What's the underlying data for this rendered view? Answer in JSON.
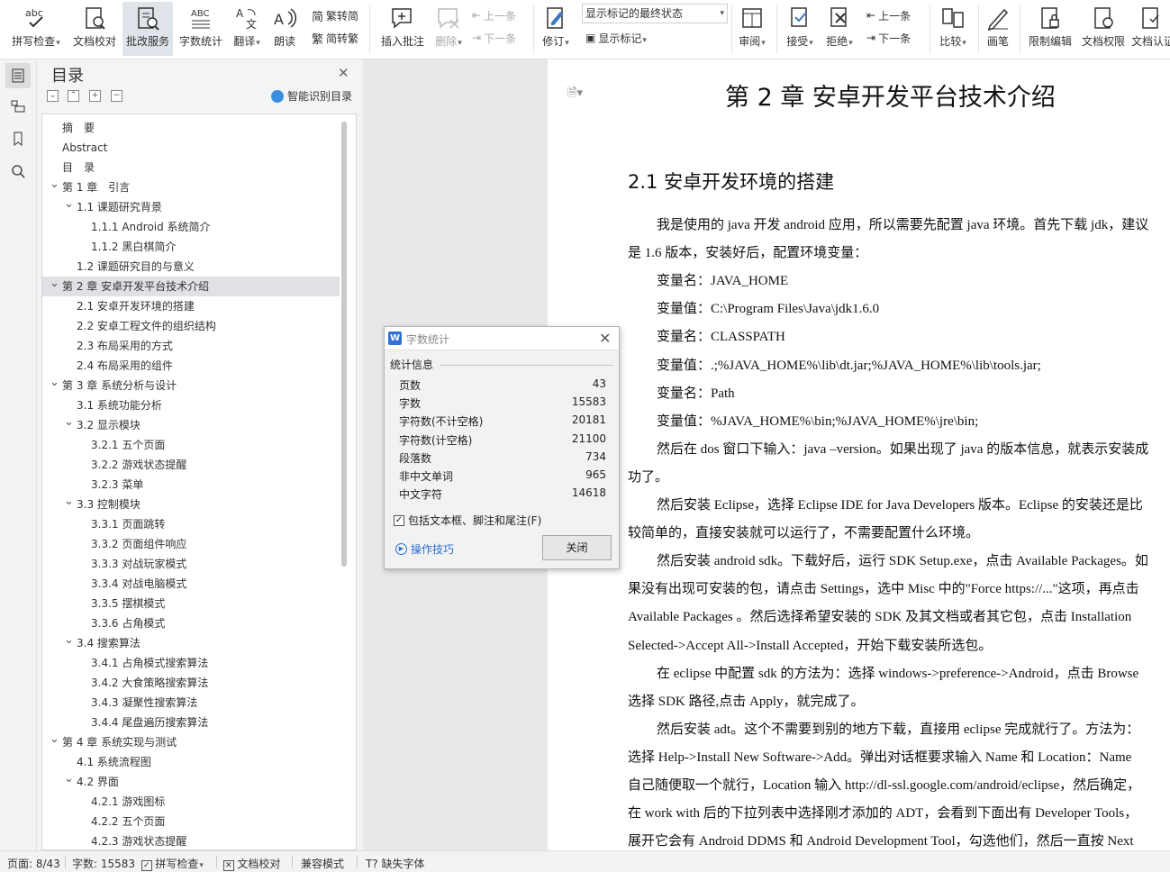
{
  "ribbon": {
    "spell_check": "拼写检查",
    "doc_proof": "文档校对",
    "batch_service": "批改服务",
    "word_count": "字数统计",
    "translate": "翻译",
    "read_aloud": "朗读",
    "trad_to_simp": "繁转简",
    "simp_to_trad": "简转繁",
    "insert_comment": "插入批注",
    "delete": "删除",
    "prev_comment": "上一条",
    "next_comment": "下一条",
    "revise": "修订",
    "markup_state": "显示标记的最终状态",
    "show_markup": "显示标记",
    "review": "审阅",
    "accept": "接受",
    "reject": "拒绝",
    "prev_change": "上一条",
    "next_change": "下一条",
    "compare": "比较",
    "pen": "画笔",
    "restrict_edit": "限制编辑",
    "doc_permission": "文档权限",
    "doc_certify": "文档认证"
  },
  "toc": {
    "title": "目录",
    "smart_label": "智能识别目录",
    "items": [
      {
        "text": "摘　要",
        "level": 0,
        "toggle": ""
      },
      {
        "text": "Abstract",
        "level": 0,
        "toggle": ""
      },
      {
        "text": "目　录",
        "level": 0,
        "toggle": ""
      },
      {
        "text": "第 1 章　引言",
        "level": 0,
        "toggle": "v"
      },
      {
        "text": "1.1 课题研究背景",
        "level": 1,
        "toggle": "v"
      },
      {
        "text": "1.1.1 Android 系统简介",
        "level": 2,
        "toggle": ""
      },
      {
        "text": "1.1.2 黑白棋简介",
        "level": 2,
        "toggle": ""
      },
      {
        "text": "1.2 课题研究目的与意义",
        "level": 1,
        "toggle": ""
      },
      {
        "text": "第 2 章 安卓开发平台技术介绍",
        "level": 0,
        "toggle": "v",
        "selected": true
      },
      {
        "text": "2.1 安卓开发环境的搭建",
        "level": 1,
        "toggle": ""
      },
      {
        "text": "2.2 安卓工程文件的组织结构",
        "level": 1,
        "toggle": ""
      },
      {
        "text": "2.3 布局采用的方式",
        "level": 1,
        "toggle": ""
      },
      {
        "text": "2.4 布局采用的组件",
        "level": 1,
        "toggle": ""
      },
      {
        "text": "第 3 章 系统分析与设计",
        "level": 0,
        "toggle": "v"
      },
      {
        "text": "3.1 系统功能分析",
        "level": 1,
        "toggle": ""
      },
      {
        "text": "3.2 显示模块",
        "level": 1,
        "toggle": "v"
      },
      {
        "text": "3.2.1 五个页面",
        "level": 2,
        "toggle": ""
      },
      {
        "text": "3.2.2 游戏状态提醒",
        "level": 2,
        "toggle": ""
      },
      {
        "text": "3.2.3 菜单",
        "level": 2,
        "toggle": ""
      },
      {
        "text": "3.3 控制模块",
        "level": 1,
        "toggle": "v"
      },
      {
        "text": "3.3.1 页面跳转",
        "level": 2,
        "toggle": ""
      },
      {
        "text": "3.3.2 页面组件响应",
        "level": 2,
        "toggle": ""
      },
      {
        "text": "3.3.3 对战玩家模式",
        "level": 2,
        "toggle": ""
      },
      {
        "text": "3.3.4 对战电脑模式",
        "level": 2,
        "toggle": ""
      },
      {
        "text": "3.3.5 摆棋模式",
        "level": 2,
        "toggle": ""
      },
      {
        "text": "3.3.6 占角模式",
        "level": 2,
        "toggle": ""
      },
      {
        "text": "3.4 搜索算法",
        "level": 1,
        "toggle": "v"
      },
      {
        "text": "3.4.1 占角模式搜索算法",
        "level": 2,
        "toggle": ""
      },
      {
        "text": "3.4.2 大食策略搜索算法",
        "level": 2,
        "toggle": ""
      },
      {
        "text": "3.4.3 凝聚性搜索算法",
        "level": 2,
        "toggle": ""
      },
      {
        "text": "3.4.4 尾盘遍历搜索算法",
        "level": 2,
        "toggle": ""
      },
      {
        "text": "第 4 章 系统实现与测试",
        "level": 0,
        "toggle": "v"
      },
      {
        "text": "4.1 系统流程图",
        "level": 1,
        "toggle": ""
      },
      {
        "text": "4.2 界面",
        "level": 1,
        "toggle": "v"
      },
      {
        "text": "4.2.1 游戏图标",
        "level": 2,
        "toggle": ""
      },
      {
        "text": "4.2.2 五个页面",
        "level": 2,
        "toggle": ""
      },
      {
        "text": "4.2.3 游戏状态提醒",
        "level": 2,
        "toggle": ""
      }
    ]
  },
  "document": {
    "chapter_title": "第 2 章  安卓开发平台技术介绍",
    "section_title": "2.1  安卓开发环境的搭建",
    "lines": [
      {
        "text": "我是使用的 java 开发 android 应用，所以需要先配置 java 环境。首先下载 jdk，建议",
        "indent": true
      },
      {
        "text": "是 1.6 版本，安装好后，配置环境变量：",
        "indent": false
      },
      {
        "text": "变量名：JAVA_HOME",
        "indent": true
      },
      {
        "text": "变量值：C:\\Program Files\\Java\\jdk1.6.0",
        "indent": true
      },
      {
        "text": "变量名：CLASSPATH",
        "indent": true
      },
      {
        "text": "变量值：.;%JAVA_HOME%\\lib\\dt.jar;%JAVA_HOME%\\lib\\tools.jar;",
        "indent": true
      },
      {
        "text": "变量名：Path",
        "indent": true
      },
      {
        "text": "变量值：%JAVA_HOME%\\bin;%JAVA_HOME%\\jre\\bin;",
        "indent": true
      },
      {
        "text": "然后在 dos 窗口下输入：java –version。如果出现了 java 的版本信息，就表示安装成",
        "indent": true
      },
      {
        "text": "功了。",
        "indent": false
      },
      {
        "text": "然后安装 Eclipse，选择 Eclipse IDE for Java Developers 版本。Eclipse 的安装还是比",
        "indent": true
      },
      {
        "text": "较简单的，直接安装就可以运行了，不需要配置什么环境。",
        "indent": false
      },
      {
        "text": "然后安装 android sdk。下载好后，运行 SDK Setup.exe，点击 Available Packages。如",
        "indent": true
      },
      {
        "text": "果没有出现可安装的包，请点击 Settings，选中 Misc 中的\"Force https://...\"这项，再点击",
        "indent": false
      },
      {
        "text": "Available Packages 。然后选择希望安装的 SDK 及其文档或者其它包，点击 Installation",
        "indent": false
      },
      {
        "text": "Selected->Accept All->Install Accepted，开始下载安装所选包。",
        "indent": false
      },
      {
        "text": "在 eclipse 中配置 sdk 的方法为：选择 windows->preference->Android，点击 Browse",
        "indent": true
      },
      {
        "text": "选择 SDK 路径,点击 Apply，就完成了。",
        "indent": false
      },
      {
        "text": "然后安装 adt。这个不需要到别的地方下载，直接用 eclipse 完成就行了。方法为：",
        "indent": true
      },
      {
        "text": "选择 Help->Install New Software->Add。弹出对话框要求输入 Name 和 Location：Name",
        "indent": false
      },
      {
        "text": "自己随便取一个就行，Location 输入 http://dl-ssl.google.com/android/eclipse，然后确定，",
        "indent": false
      },
      {
        "text": "在 work with 后的下拉列表中选择刚才添加的 ADT，会看到下面出有 Developer Tools，",
        "indent": false
      },
      {
        "text": "展开它会有 Android DDMS 和 Android Development Tool，勾选他们，然后一直按 Next",
        "indent": false
      }
    ]
  },
  "dialog": {
    "title": "字数统计",
    "section": "统计信息",
    "stats": [
      {
        "label": "页数",
        "value": "43"
      },
      {
        "label": "字数",
        "value": "15583"
      },
      {
        "label": "字符数(不计空格)",
        "value": "20181"
      },
      {
        "label": "字符数(计空格)",
        "value": "21100"
      },
      {
        "label": "段落数",
        "value": "734"
      },
      {
        "label": "非中文单词",
        "value": "965"
      },
      {
        "label": "中文字符",
        "value": "14618"
      }
    ],
    "checkbox_label": "包括文本框、脚注和尾注(F)",
    "tips_label": "操作技巧",
    "close_label": "关闭"
  },
  "status": {
    "page": "页面: 8/43",
    "words": "字数: 15583",
    "spell_check": "拼写检查",
    "doc_proof": "文档校对",
    "compat": "兼容模式",
    "missing_font": "缺失字体"
  }
}
